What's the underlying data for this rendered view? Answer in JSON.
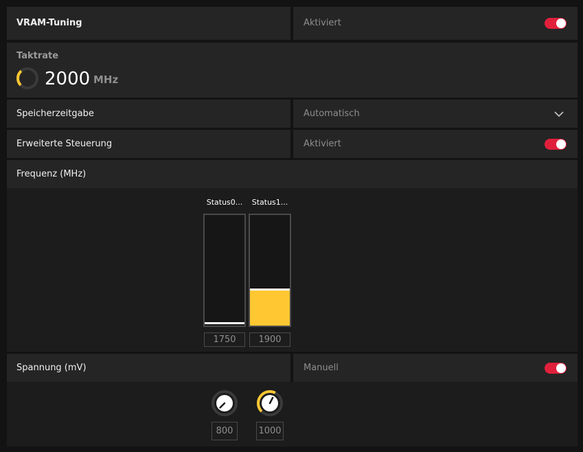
{
  "vram": {
    "title": "VRAM-Tuning",
    "status": "Aktiviert",
    "enabled": true
  },
  "clock": {
    "label": "Taktrate",
    "value": "2000",
    "unit": "MHz",
    "gauge_fraction": 0.35
  },
  "memory_timing": {
    "label": "Speicherzeitgabe",
    "value": "Automatisch"
  },
  "advanced": {
    "label": "Erweiterte Steuerung",
    "status": "Aktiviert",
    "enabled": true
  },
  "frequency": {
    "label": "Frequenz (MHz)",
    "states": [
      {
        "label": "Status0...",
        "value": "1750",
        "fill_fraction": 0.0
      },
      {
        "label": "Status1...",
        "value": "1900",
        "fill_fraction": 0.33
      }
    ]
  },
  "voltage": {
    "label": "Spannung (mV)",
    "mode": "Manuell",
    "enabled": true,
    "states": [
      {
        "value": "800",
        "fraction": 0.0
      },
      {
        "value": "1000",
        "fraction": 0.6
      }
    ]
  },
  "colors": {
    "accent": "#ffc832",
    "toggle_on": "#e0203b",
    "panel": "#252525",
    "background": "#131313"
  },
  "icons": [
    "chevron-down-icon",
    "gauge-icon",
    "knob-icon"
  ]
}
